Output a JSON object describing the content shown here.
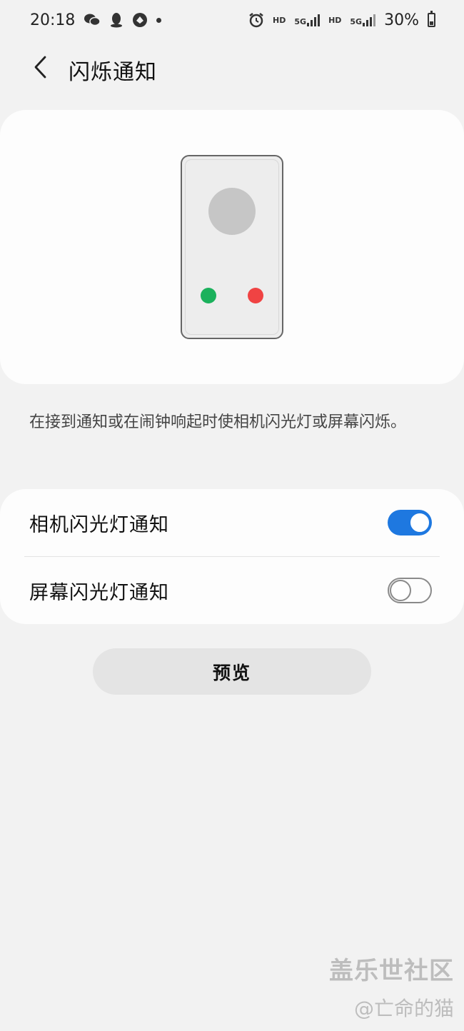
{
  "status_bar": {
    "time": "20:18",
    "left_icons": [
      "wechat-icon",
      "qq-icon",
      "app-icon",
      "notification-dot"
    ],
    "right_icons": [
      "alarm-icon",
      "hd-badge",
      "5g-signal-icon",
      "hd-badge",
      "5g-signal-icon"
    ],
    "hd_label": "HD",
    "network_label": "5G",
    "battery_percent": "30%"
  },
  "header": {
    "back_icon": "chevron-left-icon",
    "title": "闪烁通知"
  },
  "illustration": {
    "accept_color": "#1bb15c",
    "decline_color": "#f04343"
  },
  "description": "在接到通知或在闹钟响起时使相机闪光灯或屏幕闪烁。",
  "settings": [
    {
      "label": "相机闪光灯通知",
      "enabled": true
    },
    {
      "label": "屏幕闪光灯通知",
      "enabled": false
    }
  ],
  "preview_button": {
    "label": "预览"
  },
  "watermark": {
    "brand": "盖乐世社区",
    "user": "@亡命的猫"
  },
  "colors": {
    "accent": "#1e78e0",
    "background": "#f2f2f2",
    "card": "#fdfdfd"
  }
}
